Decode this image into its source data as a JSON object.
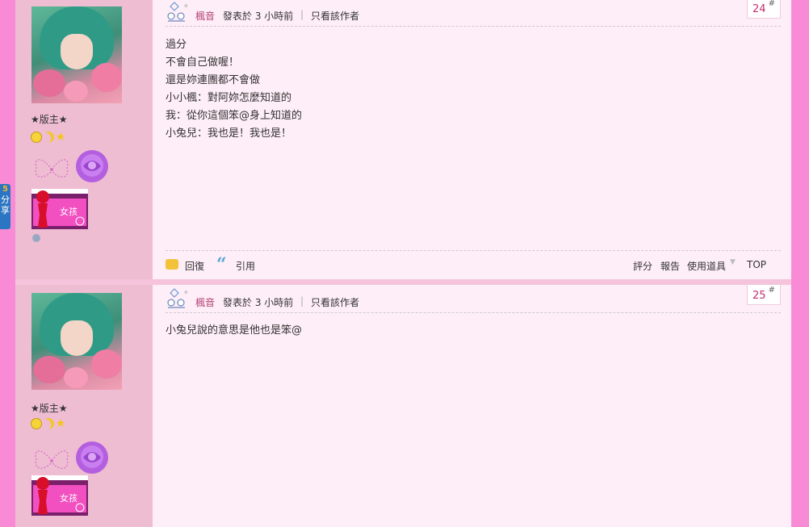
{
  "posts": [
    {
      "author": "楓音",
      "posted": "發表於 3 小時前",
      "only_author": "只看該作者",
      "floor": "24",
      "floor_sup": "#",
      "rank": "★版主★",
      "badge_text": "女孩",
      "lines": [
        "過分",
        "不會自己做喔！",
        "還是妳連團都不會做",
        "小小楓：對阿妳怎麼知道的",
        "我：從你這個笨@身上知道的",
        "小兔兒：我也是！我也是！"
      ]
    },
    {
      "author": "楓音",
      "posted": "發表於 3 小時前",
      "only_author": "只看該作者",
      "floor": "25",
      "floor_sup": "#",
      "rank": "★版主★",
      "badge_text": "女孩",
      "lines": [
        "小兔兒說的意思是他也是笨@"
      ]
    }
  ],
  "actions": {
    "reply": "回復",
    "quote": "引用",
    "rate": "評分",
    "report": "報告",
    "use_tool": "使用道具",
    "top": "TOP"
  },
  "share": {
    "top": "5",
    "line1": "分",
    "line2": "享"
  },
  "colors": {
    "accent": "#b5457a",
    "floor": "#c03070",
    "background": "#f98ad6"
  },
  "icons": [
    "reply-icon",
    "quote-icon",
    "dropdown-caret-icon",
    "butterfly-icon",
    "rose-icon",
    "moon-icon",
    "sun-icon",
    "star-icon"
  ]
}
